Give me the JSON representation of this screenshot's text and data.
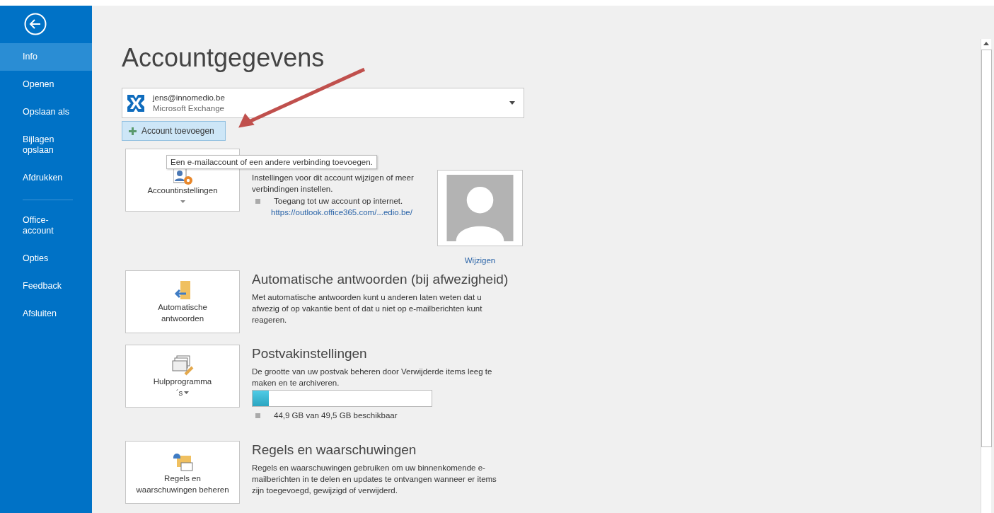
{
  "sidebar": {
    "groups": [
      [
        {
          "label": "Info",
          "selected": true
        },
        {
          "label": "Openen",
          "selected": false
        },
        {
          "label": "Opslaan als",
          "selected": false
        },
        {
          "label": "Bijlagen opslaan",
          "selected": false
        },
        {
          "label": "Afdrukken",
          "selected": false
        }
      ],
      [
        {
          "label": "Office-account",
          "selected": false
        },
        {
          "label": "Opties",
          "selected": false
        },
        {
          "label": "Feedback",
          "selected": false
        },
        {
          "label": "Afsluiten",
          "selected": false
        }
      ]
    ]
  },
  "page_title": "Accountgegevens",
  "account": {
    "email": "jens@innomedio.be",
    "type": "Microsoft Exchange"
  },
  "add_account_button": "Account toevoegen",
  "tooltip": "Een e-mailaccount of een andere verbinding toevoegen.",
  "sections": [
    {
      "kind": "account",
      "button": [
        "Accountinstellingen"
      ],
      "dropdown": true,
      "description": "Instellingen voor dit account wijzigen of meer verbindingen instellen.",
      "bullet": "Toegang tot uw account op internet.",
      "link": "https://outlook.office365.com/...edio.be/",
      "photo_link": "Wijzigen"
    },
    {
      "kind": "auto-reply",
      "button": [
        "Automatische",
        "antwoorden"
      ],
      "dropdown": false,
      "heading": "Automatische antwoorden (bij afwezigheid)",
      "description": "Met automatische antwoorden kunt u anderen laten weten dat u afwezig of op vakantie bent of dat u niet op e-mailberichten kunt reageren."
    },
    {
      "kind": "mailbox",
      "button": [
        "Hulpprogramma",
        "´s"
      ],
      "dropdown": true,
      "heading": "Postvakinstellingen",
      "description": "De grootte van uw postvak beheren door Verwijderde items leeg te maken en te archiveren.",
      "level": 0.09,
      "bullet": "44,9 GB van 49,5 GB beschikbaar"
    },
    {
      "kind": "rules",
      "button": [
        "Regels en",
        "waarschuwingen beheren"
      ],
      "dropdown": false,
      "heading": "Regels en waarschuwingen",
      "description": "Regels en waarschuwingen gebruiken om uw binnenkomende e-mailberichten in te delen en updates te ontvangen wanneer er items zijn toegevoegd, gewijzigd of verwijderd."
    }
  ]
}
